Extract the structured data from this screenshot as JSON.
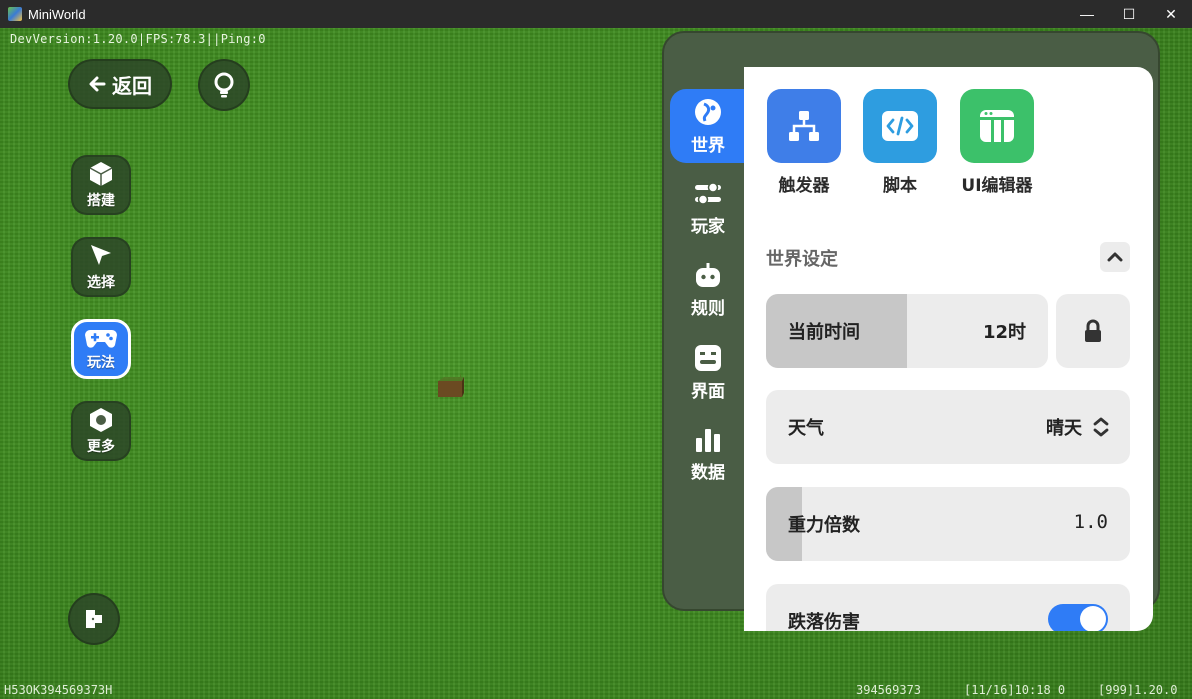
{
  "window": {
    "title": "MiniWorld",
    "minimize_glyph": "—",
    "maximize_glyph": "☐",
    "close_glyph": "✕"
  },
  "hud": {
    "dev_info": "DevVersion:1.20.0|FPS:78.3||Ping:0",
    "bottom_left": "H53OK394569373H",
    "bottom_uid": "394569373",
    "bottom_time": "[11/16]10:18 0",
    "bottom_ver": "[999]1.20.0"
  },
  "left": {
    "back_label": "返回",
    "tools": [
      {
        "label": "搭建",
        "icon": "cube-icon"
      },
      {
        "label": "选择",
        "icon": "cursor-icon"
      },
      {
        "label": "玩法",
        "icon": "gamepad-icon"
      },
      {
        "label": "更多",
        "icon": "hexagon-icon"
      }
    ],
    "active_tool": "玩法"
  },
  "panel": {
    "tabs": [
      {
        "label": "世界",
        "icon": "globe-icon"
      },
      {
        "label": "玩家",
        "icon": "sliders-icon"
      },
      {
        "label": "规则",
        "icon": "robot-icon"
      },
      {
        "label": "界面",
        "icon": "screen-face-icon"
      },
      {
        "label": "数据",
        "icon": "bar-chart-icon"
      }
    ],
    "active_tab": "世界",
    "tools": [
      {
        "label": "触发器",
        "icon": "hierarchy-icon",
        "color": "#3f7ee8"
      },
      {
        "label": "脚本",
        "icon": "code-icon",
        "color": "#2e9de0"
      },
      {
        "label": "UI编辑器",
        "icon": "layout-icon",
        "color": "#3cc16a"
      }
    ],
    "section_title": "世界设定",
    "settings": {
      "time_label": "当前时间",
      "time_value": "12时",
      "time_fill": 0.5,
      "weather_label": "天气",
      "weather_value": "晴天",
      "gravity_label": "重力倍数",
      "gravity_value": "1.0",
      "gravity_fill": 0.1,
      "fall_damage_label": "跌落伤害",
      "fall_damage_on": true
    }
  },
  "colors": {
    "accent": "#2f7cf6",
    "panel_dark": "#4a5d45",
    "grass": "#3f8d20"
  }
}
